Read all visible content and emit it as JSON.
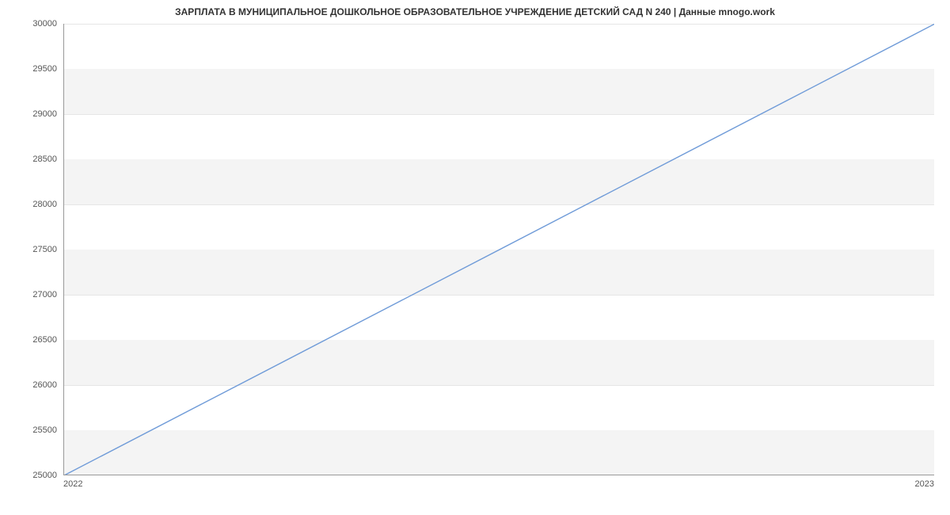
{
  "chart_data": {
    "type": "line",
    "title": "ЗАРПЛАТА В МУНИЦИПАЛЬНОЕ ДОШКОЛЬНОЕ ОБРАЗОВАТЕЛЬНОЕ УЧРЕЖДЕНИЕ ДЕТСКИЙ САД N 240 | Данные mnogo.work",
    "x": [
      "2022",
      "2023"
    ],
    "values": [
      25000,
      30000
    ],
    "xlabel": "",
    "ylabel": "",
    "ylim": [
      25000,
      30000
    ],
    "yticks": [
      25000,
      25500,
      26000,
      26500,
      27000,
      27500,
      28000,
      28500,
      29000,
      29500,
      30000
    ],
    "line_color": "#6f9bd8"
  }
}
